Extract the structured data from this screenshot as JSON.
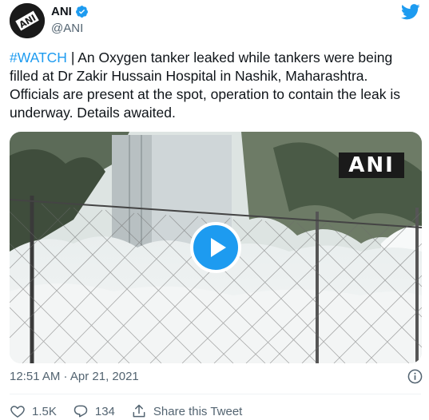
{
  "author": {
    "display_name": "ANI",
    "handle": "@ANI",
    "avatar_text": "ANI",
    "verified": true
  },
  "tweet": {
    "hashtag": "#WATCH",
    "text": " | An Oxygen tanker leaked while tankers were being filled at Dr Zakir Hussain Hospital in Nashik, Maharashtra. Officials are present at the spot, operation to contain the leak is underway. Details awaited."
  },
  "media": {
    "type": "video",
    "watermark": "ANI",
    "play_icon": "play-icon"
  },
  "meta": {
    "timestamp": "12:51 AM · Apr 21, 2021"
  },
  "actions": {
    "likes": "1.5K",
    "replies": "134",
    "share_label": "Share this Tweet"
  },
  "colors": {
    "accent": "#1d9bf0",
    "text": "#0f1419",
    "secondary": "#536471"
  }
}
